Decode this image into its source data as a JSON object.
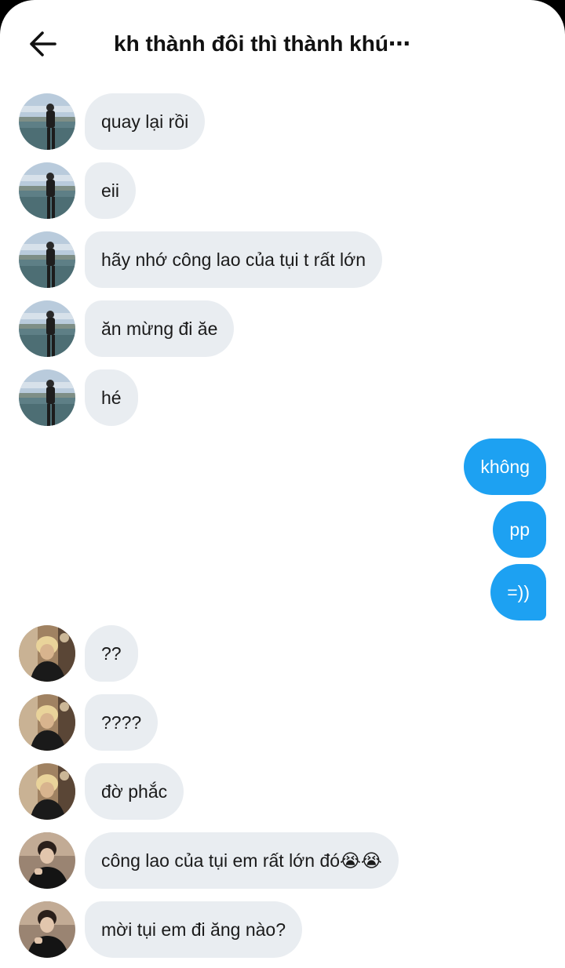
{
  "header": {
    "title": "kh thành đôi thì thành khú⋯",
    "back_icon": "arrow-left-icon"
  },
  "colors": {
    "incoming_bubble": "#e9edf1",
    "outgoing_bubble": "#1da1f2",
    "text": "#1a1a1a"
  },
  "messages": [
    {
      "text": "quay lại rồi"
    },
    {
      "text": "eii"
    },
    {
      "text": "hãy nhớ công lao của tụi t rất lớn"
    },
    {
      "text": "ăn mừng đi ăe"
    },
    {
      "text": "hé"
    },
    {
      "text": "không"
    },
    {
      "text": "pp"
    },
    {
      "text": "=))"
    },
    {
      "text": "??"
    },
    {
      "text": "????"
    },
    {
      "text": "đờ phắc"
    },
    {
      "text": "công lao của tụi em rất lớn đó😭😭"
    },
    {
      "text": "mời tụi em đi ăng nào?"
    }
  ]
}
